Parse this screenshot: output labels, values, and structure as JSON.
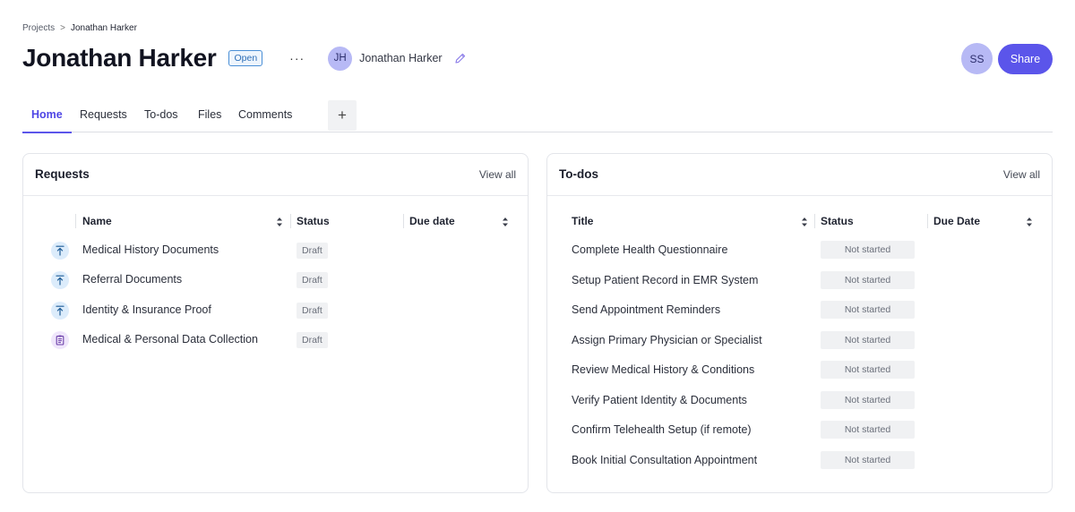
{
  "breadcrumb": {
    "parent": "Projects",
    "separator": ">",
    "current": "Jonathan Harker"
  },
  "header": {
    "title": "Jonathan Harker",
    "status_badge": "Open",
    "more_label": "···",
    "owner": {
      "initials": "JH",
      "name": "Jonathan Harker"
    },
    "user_initials": "SS",
    "share_label": "Share"
  },
  "tabs": [
    {
      "label": "Home",
      "active": true
    },
    {
      "label": "Requests"
    },
    {
      "label": "To-dos"
    },
    {
      "label": "Files"
    },
    {
      "label": "Comments"
    }
  ],
  "add_tab_label": "+",
  "requests": {
    "title": "Requests",
    "view_all": "View all",
    "columns": {
      "name": "Name",
      "status": "Status",
      "due_date": "Due date"
    },
    "rows": [
      {
        "icon": "upload-icon",
        "name": "Medical History Documents",
        "status": "Draft",
        "due_date": ""
      },
      {
        "icon": "upload-icon",
        "name": "Referral Documents",
        "status": "Draft",
        "due_date": ""
      },
      {
        "icon": "upload-icon",
        "name": "Identity & Insurance Proof",
        "status": "Draft",
        "due_date": ""
      },
      {
        "icon": "form-icon",
        "name": "Medical & Personal Data Collection",
        "status": "Draft",
        "due_date": ""
      }
    ]
  },
  "todos": {
    "title": "To-dos",
    "view_all": "View all",
    "columns": {
      "title": "Title",
      "status": "Status",
      "due_date": "Due Date"
    },
    "rows": [
      {
        "title": "Complete Health Questionnaire",
        "status": "Not started"
      },
      {
        "title": "Setup Patient Record in EMR System",
        "status": "Not started"
      },
      {
        "title": "Send Appointment Reminders",
        "status": "Not started"
      },
      {
        "title": "Assign Primary Physician or Specialist",
        "status": "Not started"
      },
      {
        "title": "Review Medical History & Conditions",
        "status": "Not started"
      },
      {
        "title": "Verify Patient Identity & Documents",
        "status": "Not started"
      },
      {
        "title": "Confirm Telehealth Setup (if remote)",
        "status": "Not started"
      },
      {
        "title": "Book Initial Consultation Appointment",
        "status": "Not started"
      }
    ]
  },
  "colors": {
    "accent": "#5b55ea",
    "avatar": "#b7b9f5",
    "badge_border": "#4a8fd6"
  }
}
